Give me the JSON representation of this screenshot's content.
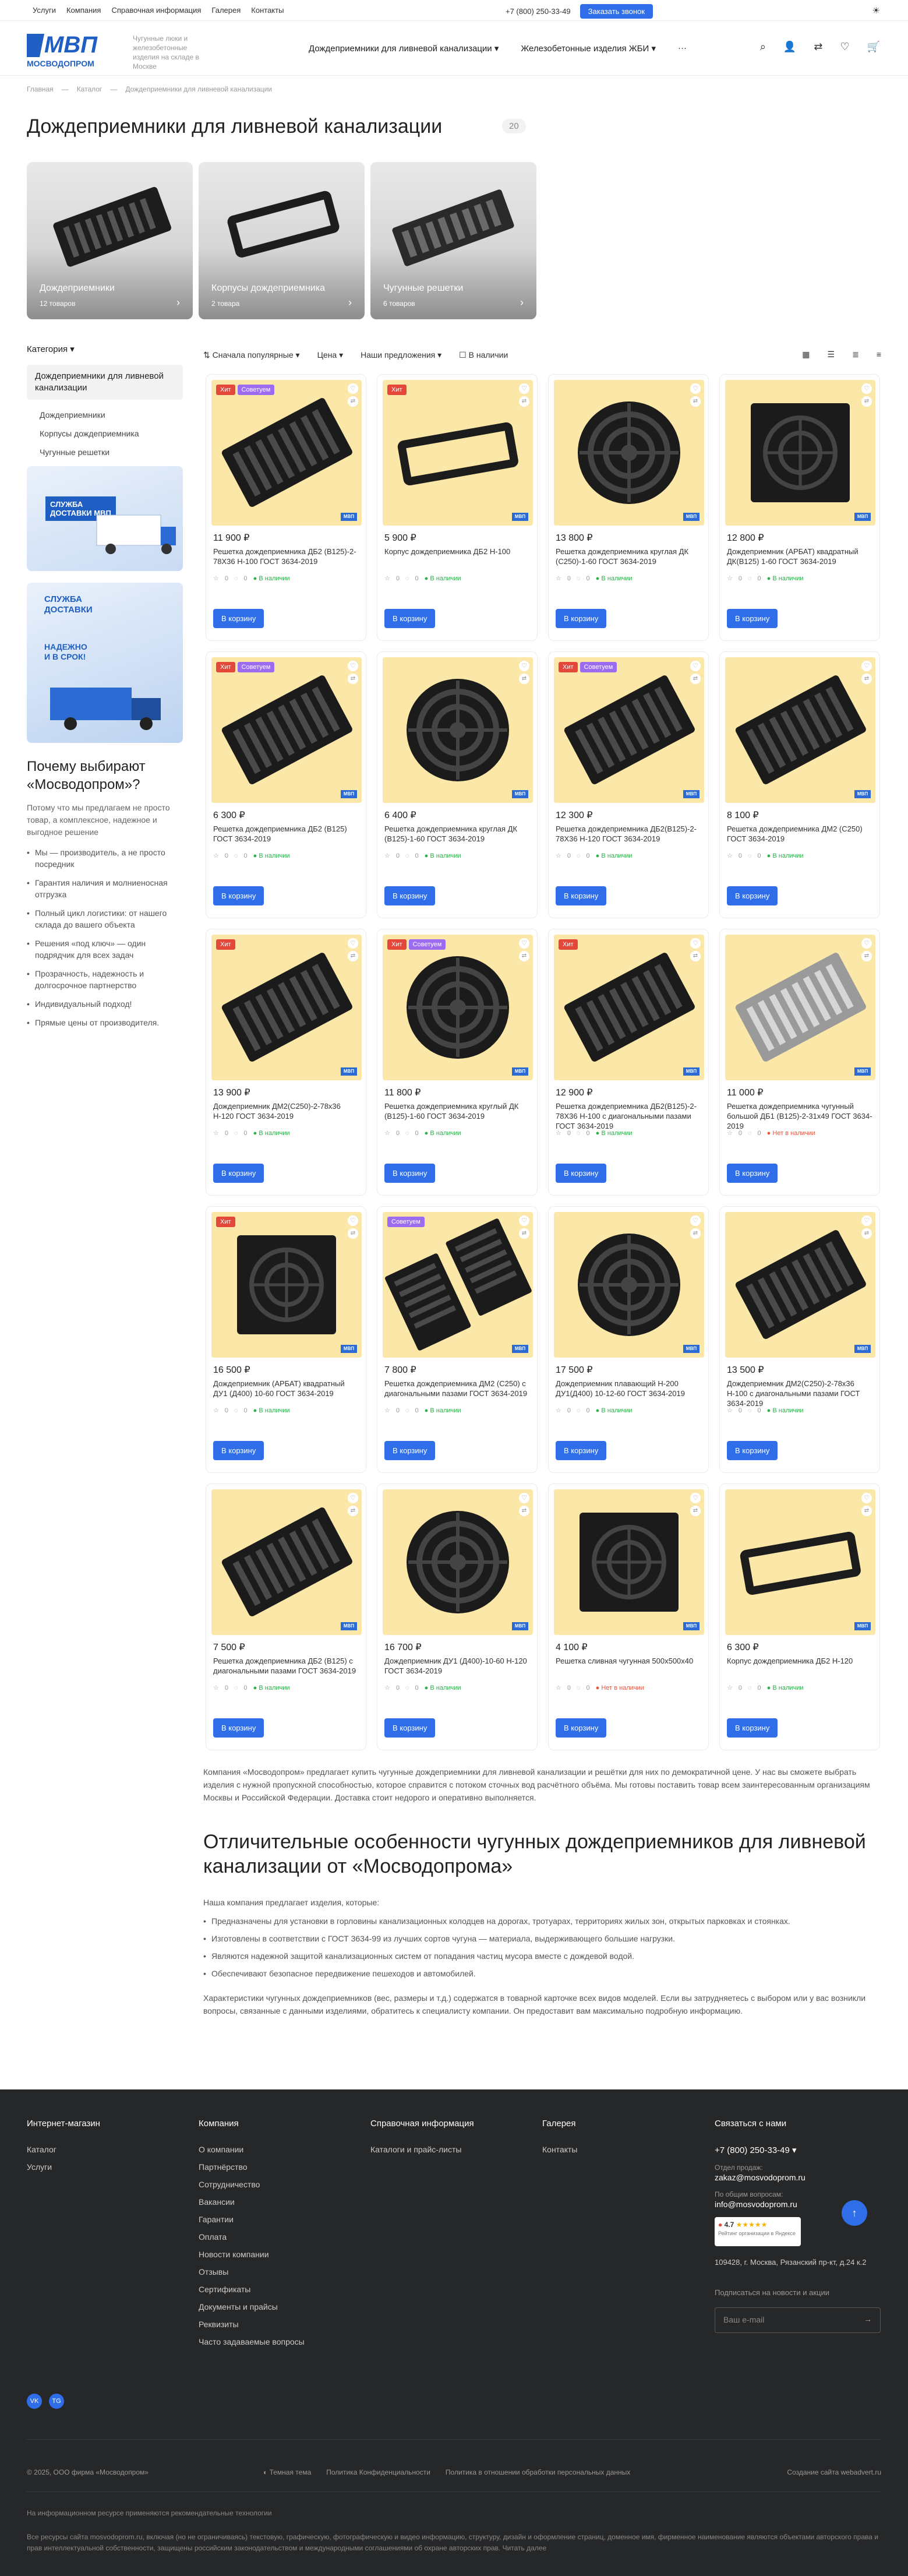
{
  "topbar": {
    "menu": [
      "Услуги",
      "Компания",
      "Справочная информация",
      "Галерея",
      "Контакты"
    ],
    "phone": "+7 (800) 250-33-49",
    "call_btn": "Заказать звонок"
  },
  "header": {
    "logo_text": "МВП",
    "logo_sub": "МОСВОДОПРОМ",
    "tagline": "Чугунные люки и железобетонные изделия на складе в Москве",
    "nav": [
      "Дождеприемники для ливневой канализации",
      "Железобетонные изделия ЖБИ",
      "···"
    ]
  },
  "breadcrumbs": [
    "Главная",
    "Каталог",
    "Дождеприемники для ливневой канализации"
  ],
  "page_title": "Дождеприемники для ливневой канализации",
  "page_count": "20",
  "categories": [
    {
      "title": "Дождеприемники",
      "sub": "12 товаров"
    },
    {
      "title": "Корпусы дождеприемника",
      "sub": "2 товара"
    },
    {
      "title": "Чугунные решетки",
      "sub": "6 товаров"
    }
  ],
  "sidebar": {
    "heading": "Категория",
    "active": "Дождеприемники для ливневой канализации",
    "items": [
      "Дождеприемники",
      "Корпусы дождеприемника",
      "Чугунные решетки"
    ]
  },
  "banners": [
    {
      "line1": "СЛУЖБА",
      "line2": "ДОСТАВКИ МВП"
    },
    {
      "line1": "СЛУЖБА",
      "line2": "ДОСТАВКИ",
      "line3": "НАДЕЖНО",
      "line4": "И В СРОК!"
    }
  ],
  "why": {
    "title": "Почему выбирают «Мосводопром»?",
    "intro": "Потому что мы предлагаем не просто товар, а комплексное, надежное и выгодное решение",
    "points": [
      "Мы — производитель, а не просто посредник",
      "Гарантия наличия и молниеносная отгрузка",
      "Полный цикл логистики: от нашего склада до вашего объекта",
      "Решения «под ключ» — один подрядчик для всех задач",
      "Прозрачность, надежность и долгосрочное партнерство",
      "Индивидуальный подход!",
      "Прямые цены от производителя."
    ]
  },
  "filters": {
    "sort": "Сначала популярные",
    "price": "Цена",
    "offers": "Наши предложения",
    "instock": "В наличии"
  },
  "labels": {
    "hit": "Хит",
    "advice": "Советуем",
    "to_cart": "В корзину",
    "mvp": "МВП",
    "in_stock": "В наличии",
    "out_stock": "Нет в наличии",
    "zero": "0"
  },
  "products": [
    {
      "price": "11 900 ₽",
      "name": "Решетка дождеприемника ДБ2 (В125)-2-78Х36 Н-100 ГОСТ 3634-2019",
      "hit": true,
      "adv": true,
      "stock": "in",
      "shape": "grate"
    },
    {
      "price": "5 900 ₽",
      "name": "Корпус дождеприемника ДБ2 Н-100",
      "hit": true,
      "adv": false,
      "stock": "in",
      "shape": "frame"
    },
    {
      "price": "13 800 ₽",
      "name": "Решетка дождеприемника круглая ДК (С250)-1-60 ГОСТ 3634-2019",
      "hit": false,
      "adv": false,
      "stock": "in",
      "shape": "round"
    },
    {
      "price": "12 800 ₽",
      "name": "Дождеприемник (АРБАТ) квадратный ДК(В125) 1-60 ГОСТ 3634-2019",
      "hit": false,
      "adv": false,
      "stock": "in",
      "shape": "square"
    },
    {
      "price": "6 300 ₽",
      "name": "Решетка дождеприемника ДБ2 (В125) ГОСТ 3634-2019",
      "hit": true,
      "adv": true,
      "stock": "in",
      "shape": "grate"
    },
    {
      "price": "6 400 ₽",
      "name": "Решетка дождеприемника круглая ДК (В125)-1-60 ГОСТ 3634-2019",
      "hit": false,
      "adv": false,
      "stock": "in",
      "shape": "round"
    },
    {
      "price": "12 300 ₽",
      "name": "Решетка дождеприемника ДБ2(В125)-2-78Х36 Н-120 ГОСТ 3634-2019",
      "hit": true,
      "adv": true,
      "stock": "in",
      "shape": "grate"
    },
    {
      "price": "8 100 ₽",
      "name": "Решетка дождеприемника ДМ2 (С250) ГОСТ 3634-2019",
      "hit": false,
      "adv": false,
      "stock": "in",
      "shape": "grate"
    },
    {
      "price": "13 900 ₽",
      "name": "Дождеприемник ДМ2(С250)-2-78х36 Н-120 ГОСТ 3634-2019",
      "hit": true,
      "adv": false,
      "stock": "in",
      "shape": "grate"
    },
    {
      "price": "11 800 ₽",
      "name": "Решетка дождеприемника круглый ДК (В125)-1-60 ГОСТ 3634-2019",
      "hit": true,
      "adv": true,
      "stock": "in",
      "shape": "round"
    },
    {
      "price": "12 900 ₽",
      "name": "Решетка дождеприемника ДБ2(В125)-2-78Х36 Н-100 с диагональными пазами ГОСТ 3634-2019",
      "hit": true,
      "adv": false,
      "stock": "in",
      "shape": "grate"
    },
    {
      "price": "11 000 ₽",
      "name": "Решетка дождеприемника чугунный большой ДБ1 (В125)-2-31х49 ГОСТ 3634-2019",
      "hit": false,
      "adv": false,
      "stock": "out",
      "shape": "grate-grey"
    },
    {
      "price": "16 500 ₽",
      "name": "Дождеприемник (АРБАТ) квадратный ДУ1 (Д400) 10-60 ГОСТ 3634-2019",
      "hit": true,
      "adv": false,
      "stock": "in",
      "shape": "square"
    },
    {
      "price": "7 800 ₽",
      "name": "Решетка дождеприемника ДМ2 (С250) с диагональными пазами ГОСТ 3634-2019",
      "hit": false,
      "adv": true,
      "stock": "in",
      "shape": "grates2"
    },
    {
      "price": "17 500 ₽",
      "name": "Дождеприемник плавающий Н-200 ДУ1(Д400) 10-12-60 ГОСТ 3634-2019",
      "hit": false,
      "adv": false,
      "stock": "in",
      "shape": "round"
    },
    {
      "price": "13 500 ₽",
      "name": "Дождеприемник ДМ2(С250)-2-78х36 Н-100 с диагональными пазами ГОСТ 3634-2019",
      "hit": false,
      "adv": false,
      "stock": "in",
      "shape": "grate"
    },
    {
      "price": "7 500 ₽",
      "name": "Решетка дождеприемника ДБ2 (В125) с диагональными пазами ГОСТ 3634-2019",
      "hit": false,
      "adv": false,
      "stock": "in",
      "shape": "grate"
    },
    {
      "price": "16 700 ₽",
      "name": "Дождеприемник ДУ1 (Д400)-10-60 Н-120 ГОСТ 3634-2019",
      "hit": false,
      "adv": false,
      "stock": "in",
      "shape": "round"
    },
    {
      "price": "4 100 ₽",
      "name": "Решетка сливная чугунная 500х500х40",
      "hit": false,
      "adv": false,
      "stock": "out",
      "shape": "square"
    },
    {
      "price": "6 300 ₽",
      "name": "Корпус дождеприемника ДБ2 Н-120",
      "hit": false,
      "adv": false,
      "stock": "in",
      "shape": "frame"
    }
  ],
  "seo": {
    "intro": "Компания «Мосводопром» предлагает купить чугунные дождеприемники для ливневой канализации и решётки для них по демократичной цене. У нас вы сможете выбрать изделия с нужной пропускной способностью, которое справится с потоком сточных вод расчётного объёма. Мы готовы поставить товар всем заинтересованным организациям Москвы и Российской Федерации. Доставка стоит недорого и оперативно выполняется.",
    "heading": "Отличительные особенности чугунных дождеприемников для ливневой канализации от «Мосводопрома»",
    "lead": "Наша компания предлагает изделия, которые:",
    "points": [
      "Предназначены для установки в горловины канализационных колодцев на дорогах, тротуарах, территориях жилых зон, открытых парковках и стоянках.",
      "Изготовлены в соответствии с ГОСТ 3634-99 из лучших сортов чугуна — материала, выдерживающего большие нагрузки.",
      "Являются надежной защитой канализационных систем от попадания частиц мусора вместе с дождевой водой.",
      "Обеспечивают безопасное передвижение пешеходов и автомобилей."
    ],
    "outro": "Характеристики чугунных дождеприемников (вес, размеры и т.д.) содержатся в товарной карточке всех видов моделей. Если вы затрудняетесь с выбором или у вас возникли вопросы, связанные с данными изделиями, обратитесь к специалисту компании. Он предоставит вам максимально подробную информацию."
  },
  "footer": {
    "cols": [
      {
        "title": "Интернет-магазин",
        "links": [
          "Каталог",
          "Услуги"
        ]
      },
      {
        "title": "Компания",
        "links": [
          "О компании",
          "Партнёрство",
          "Сотрудничество",
          "Вакансии",
          "Гарантии",
          "Оплата",
          "Новости компании",
          "Отзывы",
          "Сертификаты",
          "Документы и прайсы",
          "Реквизиты",
          "Часто задаваемые вопросы"
        ]
      },
      {
        "title": "Справочная информация",
        "links": [
          "Каталоги и прайс-листы"
        ]
      },
      {
        "title": "Галерея",
        "links": [
          "Контакты"
        ]
      }
    ],
    "contact_title": "Связаться с нами",
    "phone": "+7 (800) 250-33-49",
    "sales_label": "Отдел продаж:",
    "sales_mail": "zakaz@mosvodoprom.ru",
    "general_label": "По общим вопросам:",
    "general_mail": "info@mosvodoprom.ru",
    "rating": "4.7",
    "rating_sub": "Рейтинг организации в Яндексе",
    "address": "109428, г. Москва, Рязанский пр-кт, д.24 к.2",
    "subscribe": "Подписаться на новости и акции",
    "email_placeholder": "Ваш e-mail",
    "social": [
      "VK",
      "TG"
    ],
    "copyright": "© 2025, ООО фирма «Мосводопром»",
    "theme": "Темная тема",
    "privacy": "Политика Конфиденциальности",
    "personal": "Политика в отношении обработки персональных данных",
    "dev": "Создание сайта webadvert.ru",
    "note1": "На информационном ресурсе применяются рекомендательные технологии",
    "note2": "Все ресурсы сайта mosvodoprom.ru, включая (но не ограничиваясь) текстовую, графическую, фотографическую и видео информацию, структуру, дизайн и оформление страниц, доменное имя, фирменное наименование являются объектами авторского права и прав интеллектуальной собственности, защищены российским законодательством и международными соглашениями об охране авторских прав. Читать далее"
  }
}
